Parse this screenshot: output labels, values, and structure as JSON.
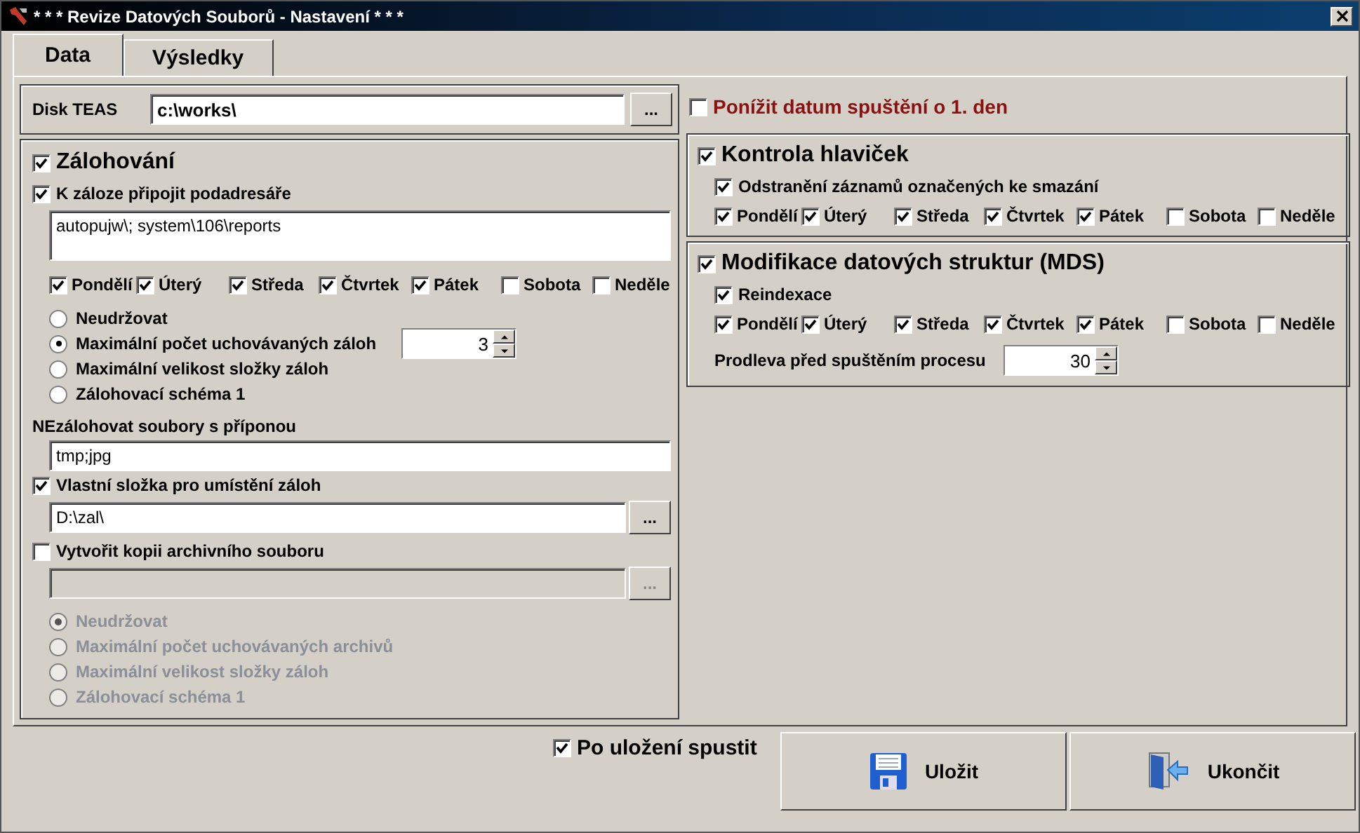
{
  "window": {
    "title": "* * * Revize Datových Souborů - Nastavení * * *"
  },
  "tabs": [
    {
      "label": "Data",
      "selected": true
    },
    {
      "label": "Výsledky",
      "selected": false
    }
  ],
  "disk": {
    "label": "Disk TEAS",
    "value": "c:\\works\\",
    "browse": "..."
  },
  "backup": {
    "title": "Zálohování",
    "checked": true,
    "subdirs": {
      "label": "K záloze připojit podadresáře",
      "checked": true,
      "value": "autopujw\\; system\\106\\reports"
    },
    "days": [
      {
        "label": "Pondělí",
        "checked": true
      },
      {
        "label": "Úterý",
        "checked": true
      },
      {
        "label": "Středa",
        "checked": true
      },
      {
        "label": "Čtvrtek",
        "checked": true
      },
      {
        "label": "Pátek",
        "checked": true
      },
      {
        "label": "Sobota",
        "checked": false
      },
      {
        "label": "Neděle",
        "checked": false
      }
    ],
    "retention": [
      {
        "label": "Neudržovat",
        "selected": false
      },
      {
        "label": "Maximální počet uchovávaných záloh",
        "selected": true,
        "value": "3"
      },
      {
        "label": "Maximální velikost složky záloh",
        "selected": false
      },
      {
        "label": "Zálohovací schéma 1",
        "selected": false
      }
    ],
    "exclude": {
      "label": "NEzálohovat soubory s příponou",
      "value": "tmp;jpg"
    },
    "folder": {
      "label": "Vlastní složka pro umístění záloh",
      "checked": true,
      "value": "D:\\zal\\",
      "browse": "..."
    },
    "archive": {
      "label": "Vytvořit kopii archivního souboru",
      "checked": false,
      "disabled": true,
      "browse": "...",
      "options": [
        {
          "label": "Neudržovat",
          "selected": true
        },
        {
          "label": "Maximální počet uchovávaných archivů",
          "selected": false
        },
        {
          "label": "Maximální velikost složky záloh",
          "selected": false
        },
        {
          "label": "Zálohovací schéma 1",
          "selected": false
        }
      ]
    }
  },
  "lower_date": {
    "label": "Ponížit datum spuštění o 1. den",
    "checked": false
  },
  "header_check": {
    "title": "Kontrola hlaviček",
    "checked": true,
    "option": {
      "label": "Odstranění záznamů označených ke smazání",
      "checked": true
    },
    "days": [
      {
        "label": "Pondělí",
        "checked": true
      },
      {
        "label": "Úterý",
        "checked": true
      },
      {
        "label": "Středa",
        "checked": true
      },
      {
        "label": "Čtvrtek",
        "checked": true
      },
      {
        "label": "Pátek",
        "checked": true
      },
      {
        "label": "Sobota",
        "checked": false
      },
      {
        "label": "Neděle",
        "checked": false
      }
    ]
  },
  "mds": {
    "title": "Modifikace datových struktur (MDS)",
    "checked": true,
    "option": {
      "label": "Reindexace",
      "checked": true
    },
    "days": [
      {
        "label": "Pondělí",
        "checked": true
      },
      {
        "label": "Úterý",
        "checked": true
      },
      {
        "label": "Středa",
        "checked": true
      },
      {
        "label": "Čtvrtek",
        "checked": true
      },
      {
        "label": "Pátek",
        "checked": true
      },
      {
        "label": "Sobota",
        "checked": false
      },
      {
        "label": "Neděle",
        "checked": false
      }
    ],
    "delay": {
      "label": "Prodleva před spuštěním procesu",
      "value": "30"
    }
  },
  "run_after_save": {
    "label": "Po uložení spustit",
    "checked": true
  },
  "buttons": [
    {
      "kind": "save",
      "label": "Uložit"
    },
    {
      "kind": "exit",
      "label": "Ukončit"
    }
  ]
}
